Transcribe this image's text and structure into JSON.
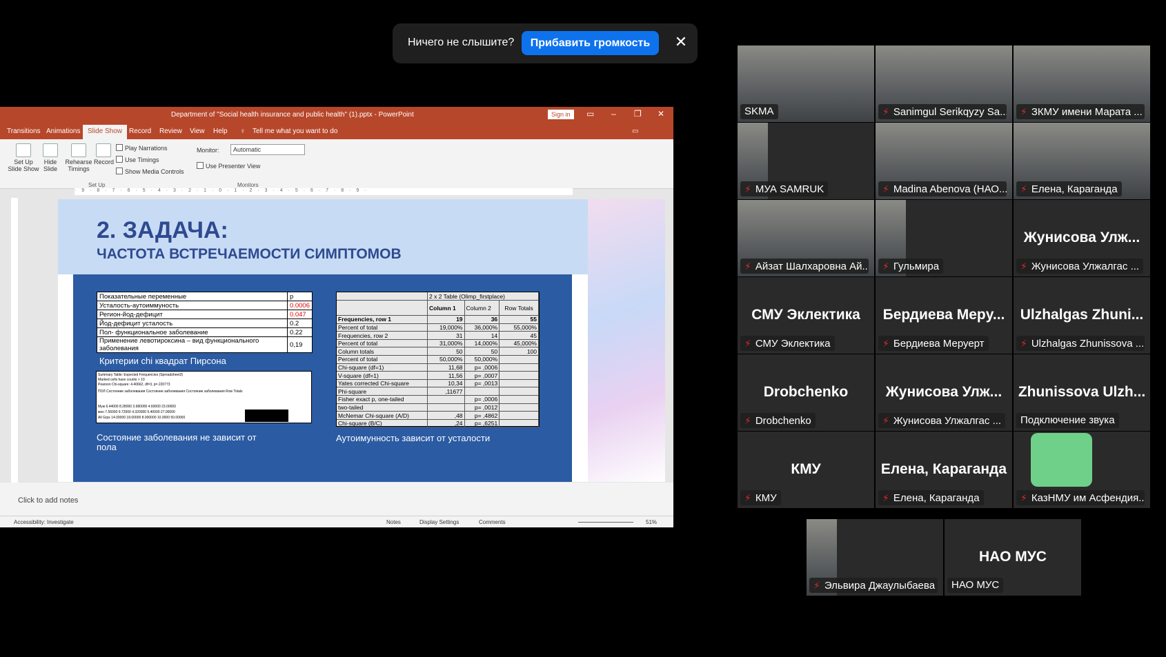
{
  "notice": {
    "text": "Ничего не слышите?",
    "button": "Прибавить громкость"
  },
  "ppt": {
    "title": "Department of \"Social health insurance and public health\" (1).pptx  -  PowerPoint",
    "sign_in": "Sign in",
    "tabs": [
      "Transitions",
      "Animations",
      "Slide Show",
      "Record",
      "Review",
      "View",
      "Help"
    ],
    "tell_me": "Tell me what you want to do",
    "ribbon": {
      "setup": "Set Up Slide Show",
      "hide": "Hide Slide",
      "rehearse": "Rehearse Timings",
      "record": "Record",
      "play": "Play Narrations",
      "timings": "Use Timings",
      "media": "Show Media Controls",
      "monitor_label": "Monitor:",
      "monitor_value": "Automatic",
      "presenter": "Use Presenter View",
      "grp_setup": "Set Up",
      "grp_monitors": "Monitors"
    },
    "ruler": "· 9 · 8 · 7 · 6 · 5 · 4 · 3 · 2 · 1 · 0 · 1 · 2 · 3 · 4 · 5 · 6 · 7 · 8 · 9 ·",
    "notes": "Click to add notes",
    "status": {
      "acc": "Accessibility: Investigate",
      "notes": "Notes",
      "display": "Display Settings",
      "comments": "Comments",
      "zoom": "51%"
    }
  },
  "slide": {
    "h1": "2. ЗАДАЧА:",
    "h2": "ЧАСТОТА ВСТРЕЧАЕМОСТИ СИМПТОМОВ",
    "table1": [
      [
        "Показательные переменные",
        "p"
      ],
      [
        "Усталость-аутоиммуность",
        "0.0006"
      ],
      [
        "Регион-йод-дефицит",
        "0.047"
      ],
      [
        "Йод-дефицит усталость",
        "0.2"
      ],
      [
        "Пол- функциональное  заболевание",
        "0.22"
      ],
      [
        "Применение левотироксина – вид функционального заболевания",
        "0,19"
      ]
    ],
    "cap1": "Критерии chi квадрат Пирсона",
    "cap2": "Состояние заболевания не зависит от пола",
    "cap3": "Аутоимунность зависит от усталости",
    "t2lines": [
      "Summary Table: Expected Frequencies (Spreadsheet3)",
      "Marked cells have counts > 10",
      "Pearson Chi-square: 4.40662, df=3, p=.220773",
      "ПОЛ  Состояние заболевания  Состояние заболевания  Состояние заболевания  Row Totals",
      "Муж   6.44000   8.28000   3.680000   4.60000   23.00000",
      "жен   7.56000   9.72000   4.320000   5.40000   27.00000",
      "All Grps  14.00000  18.00000  8.000000  10.0000  50.00000"
    ],
    "t3head": [
      "2 x 2 Table (Olimp_firstplace)",
      "Column 1",
      "Column 2",
      "Row Totals"
    ],
    "t3rows": [
      [
        "Frequencies, row 1",
        "19",
        "36",
        "55"
      ],
      [
        "Percent of total",
        "19,000%",
        "36,000%",
        "55,000%"
      ],
      [
        "Frequencies, row 2",
        "31",
        "14",
        "45"
      ],
      [
        "Percent of total",
        "31,000%",
        "14,000%",
        "45,000%"
      ],
      [
        "Column totals",
        "50",
        "50",
        "100"
      ],
      [
        "Percent of total",
        "50,000%",
        "50,000%",
        ""
      ],
      [
        "Chi-square (df=1)",
        "11,68",
        "p= ,0006",
        ""
      ],
      [
        "V-square (df=1)",
        "11,56",
        "p= ,0007",
        ""
      ],
      [
        "Yates corrected Chi-square",
        "10,34",
        "p= ,0013",
        ""
      ],
      [
        "Phi-square",
        ",11677",
        "",
        ""
      ],
      [
        "Fisher exact p, one-tailed",
        "",
        "p= ,0006",
        ""
      ],
      [
        "two-tailed",
        "",
        "p= ,0012",
        ""
      ],
      [
        "McNemar Chi-square (A/D)",
        ",48",
        "p= ,4862",
        ""
      ],
      [
        "Chi-square (B/C)",
        ",24",
        "p= ,6251",
        ""
      ]
    ]
  },
  "participants": [
    {
      "name": "SKMA",
      "big": "",
      "video": true,
      "muted": false
    },
    {
      "name": "Sanimgul Serikqyzy Sa...",
      "big": "",
      "video": true,
      "muted": true
    },
    {
      "name": "ЗКМУ имени Марата ...",
      "big": "",
      "video": true,
      "muted": true
    },
    {
      "name": "МУА SAMRUK",
      "big": "",
      "video": true,
      "muted": true
    },
    {
      "name": "Madina Abenova (НАО...",
      "big": "",
      "video": true,
      "muted": true
    },
    {
      "name": "Елена, Караганда",
      "big": "",
      "video": true,
      "muted": true
    },
    {
      "name": "Айзат Шалхаровна Ай...",
      "big": "",
      "video": true,
      "muted": true
    },
    {
      "name": "Гульмира",
      "big": "",
      "video": true,
      "muted": true
    },
    {
      "name": "Жунисова Улжалгас ...",
      "big": "Жунисова  Улж...",
      "video": false,
      "muted": true
    },
    {
      "name": "СМУ Эклектика",
      "big": "СМУ Эклектика",
      "video": false,
      "muted": true
    },
    {
      "name": "Бердиева Меруерт",
      "big": "Бердиева  Мерy...",
      "video": false,
      "muted": true
    },
    {
      "name": "Ulzhalgas Zhunissova ...",
      "big": "Ulzhalgas  Zhuni...",
      "video": false,
      "muted": true
    },
    {
      "name": "Drobchenko",
      "big": "Drobchenko",
      "video": false,
      "muted": true
    },
    {
      "name": "Жунисова Улжалгас ...",
      "big": "Жунисова  Улж...",
      "video": false,
      "muted": true
    },
    {
      "name": "Подключение звука",
      "big": "Zhunissova  Ulzh...",
      "video": false,
      "muted": false
    },
    {
      "name": "КМУ",
      "big": "КМУ",
      "video": false,
      "muted": true
    },
    {
      "name": "Елена, Караганда",
      "big": "Елена, Караганда",
      "video": false,
      "muted": true
    },
    {
      "name": "КазНМУ им Асфендия...",
      "big": "",
      "video": false,
      "muted": true,
      "avatar": true
    },
    {
      "name": "Эльвира Джаулыбаева",
      "big": "",
      "video": true,
      "muted": true
    },
    {
      "name": "НАО МУС",
      "big": "НАО МУС",
      "video": false,
      "muted": false
    }
  ]
}
